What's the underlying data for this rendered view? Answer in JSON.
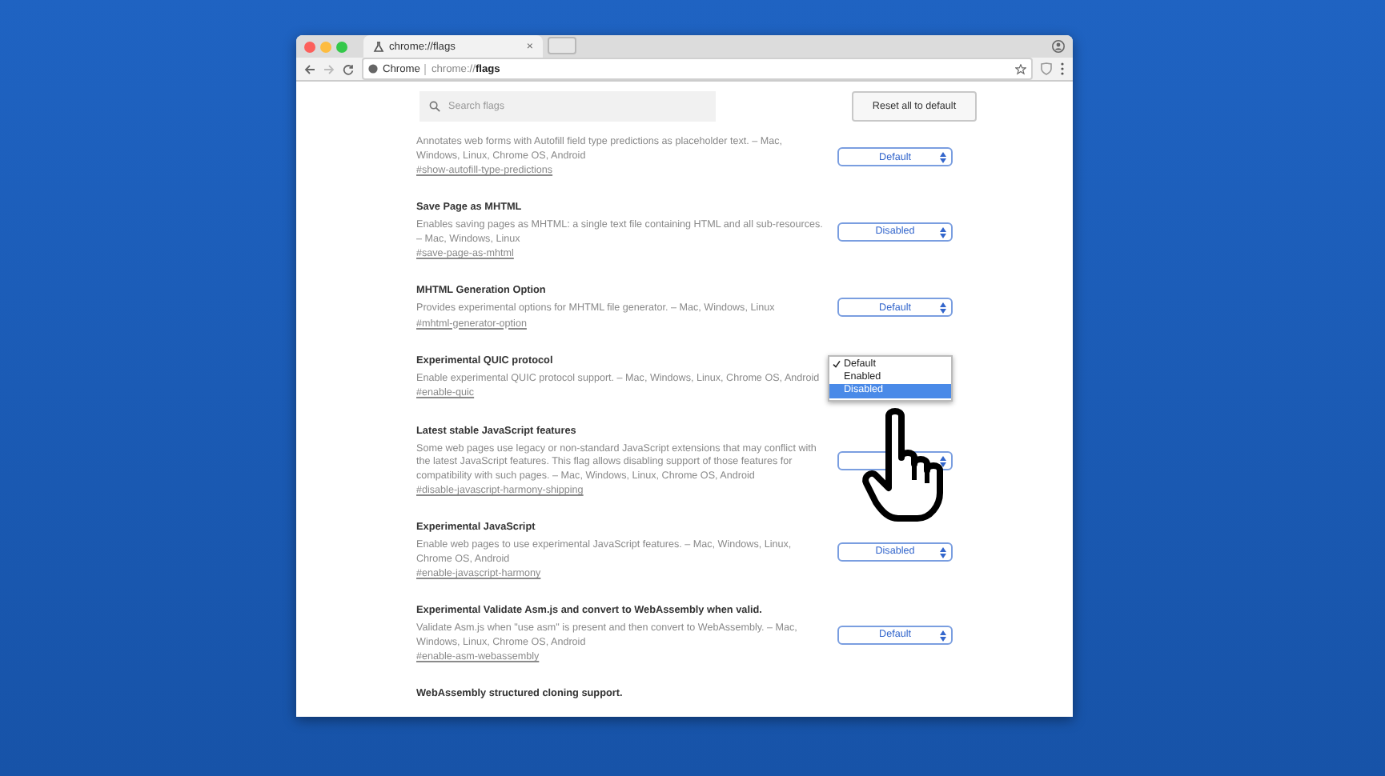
{
  "browser": {
    "tab_title": "chrome://flags",
    "tab_close": "×",
    "site": "Chrome",
    "url": "chrome://**flags**"
  },
  "search": {
    "placeholder": "Search flags"
  },
  "reset_button": "Reset all to default",
  "flags": [
    {
      "description": "Annotates web forms with Autofill field type predictions as placeholder text. – Mac, Windows, Linux, Chrome OS, Android",
      "link": "#show-autofill-type-predictions",
      "value": "Default"
    },
    {
      "title": "Save Page as MHTML",
      "description": "Enables saving pages as MHTML: a single text file containing HTML and all sub-resources. – Mac, Windows, Linux",
      "link": "#save-page-as-mhtml",
      "value": "Disabled"
    },
    {
      "title": "MHTML Generation Option",
      "description": "Provides experimental options for MHTML file generator. – Mac, Windows, Linux",
      "link": "#mhtml-generator-option",
      "value": "Default"
    },
    {
      "title": "Experimental QUIC protocol",
      "description": "Enable experimental QUIC protocol support. – Mac, Windows, Linux, Chrome OS, Android",
      "link": "#enable-quic",
      "menu": [
        {
          "label": "Default",
          "checked": true,
          "highlighted": false
        },
        {
          "label": "Enabled",
          "checked": false,
          "highlighted": false
        },
        {
          "label": "Disabled",
          "checked": false,
          "highlighted": true
        }
      ]
    },
    {
      "title": "Latest stable JavaScript features",
      "description": "Some web pages use legacy or non-standard JavaScript extensions that may conflict with the latest JavaScript features. This flag allows disabling support of those features for compatibility with such pages. – Mac, Windows, Linux, Chrome OS, Android",
      "link": "#disable-javascript-harmony-shipping"
    },
    {
      "title": "Experimental JavaScript",
      "description": "Enable web pages to use experimental JavaScript features. – Mac, Windows, Linux, Chrome OS, Android",
      "link": "#enable-javascript-harmony",
      "value": "Disabled"
    },
    {
      "title": "Experimental Validate Asm.js and convert to WebAssembly when valid.",
      "description": "Validate Asm.js when \"use asm\" is present and then convert to WebAssembly. – Mac, Windows, Linux, Chrome OS, Android",
      "link": "#enable-asm-webassembly",
      "value": "Default"
    },
    {
      "title": "WebAssembly structured cloning support."
    }
  ]
}
